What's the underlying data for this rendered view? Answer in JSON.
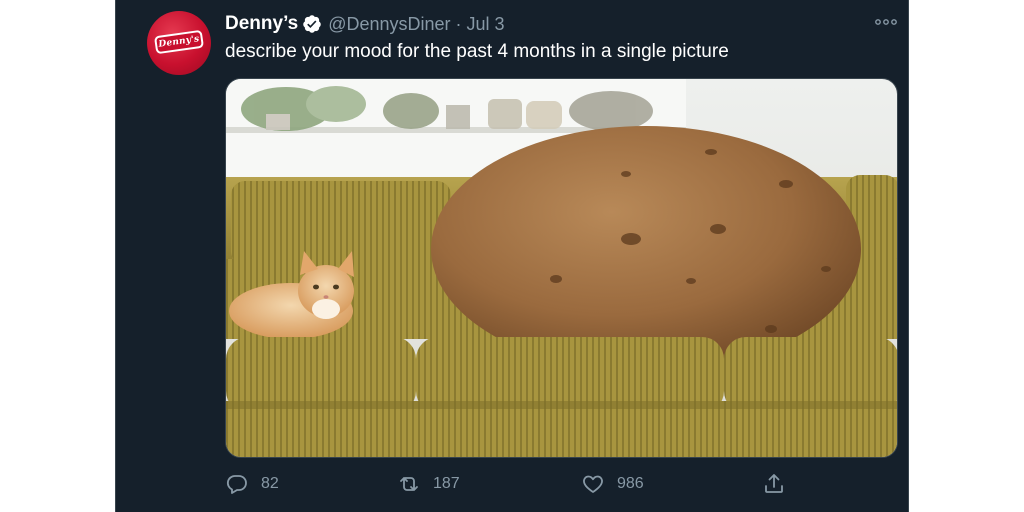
{
  "tweet": {
    "author": {
      "display_name": "Denny’s",
      "handle": "@DennysDiner",
      "avatar_text": "Denny's",
      "verified": true
    },
    "separator": "·",
    "date": "Jul 3",
    "text": "describe your mood for the past 4 months in a single picture",
    "media": {
      "description_icon": "photo-potato-on-couch-with-cat"
    },
    "actions": {
      "replies": "82",
      "retweets": "187",
      "likes": "986"
    }
  },
  "colors": {
    "background": "#15202b",
    "text": "#ffffff",
    "muted": "#8899a6",
    "verified": "#ffffff",
    "brand": "#c8102e"
  }
}
